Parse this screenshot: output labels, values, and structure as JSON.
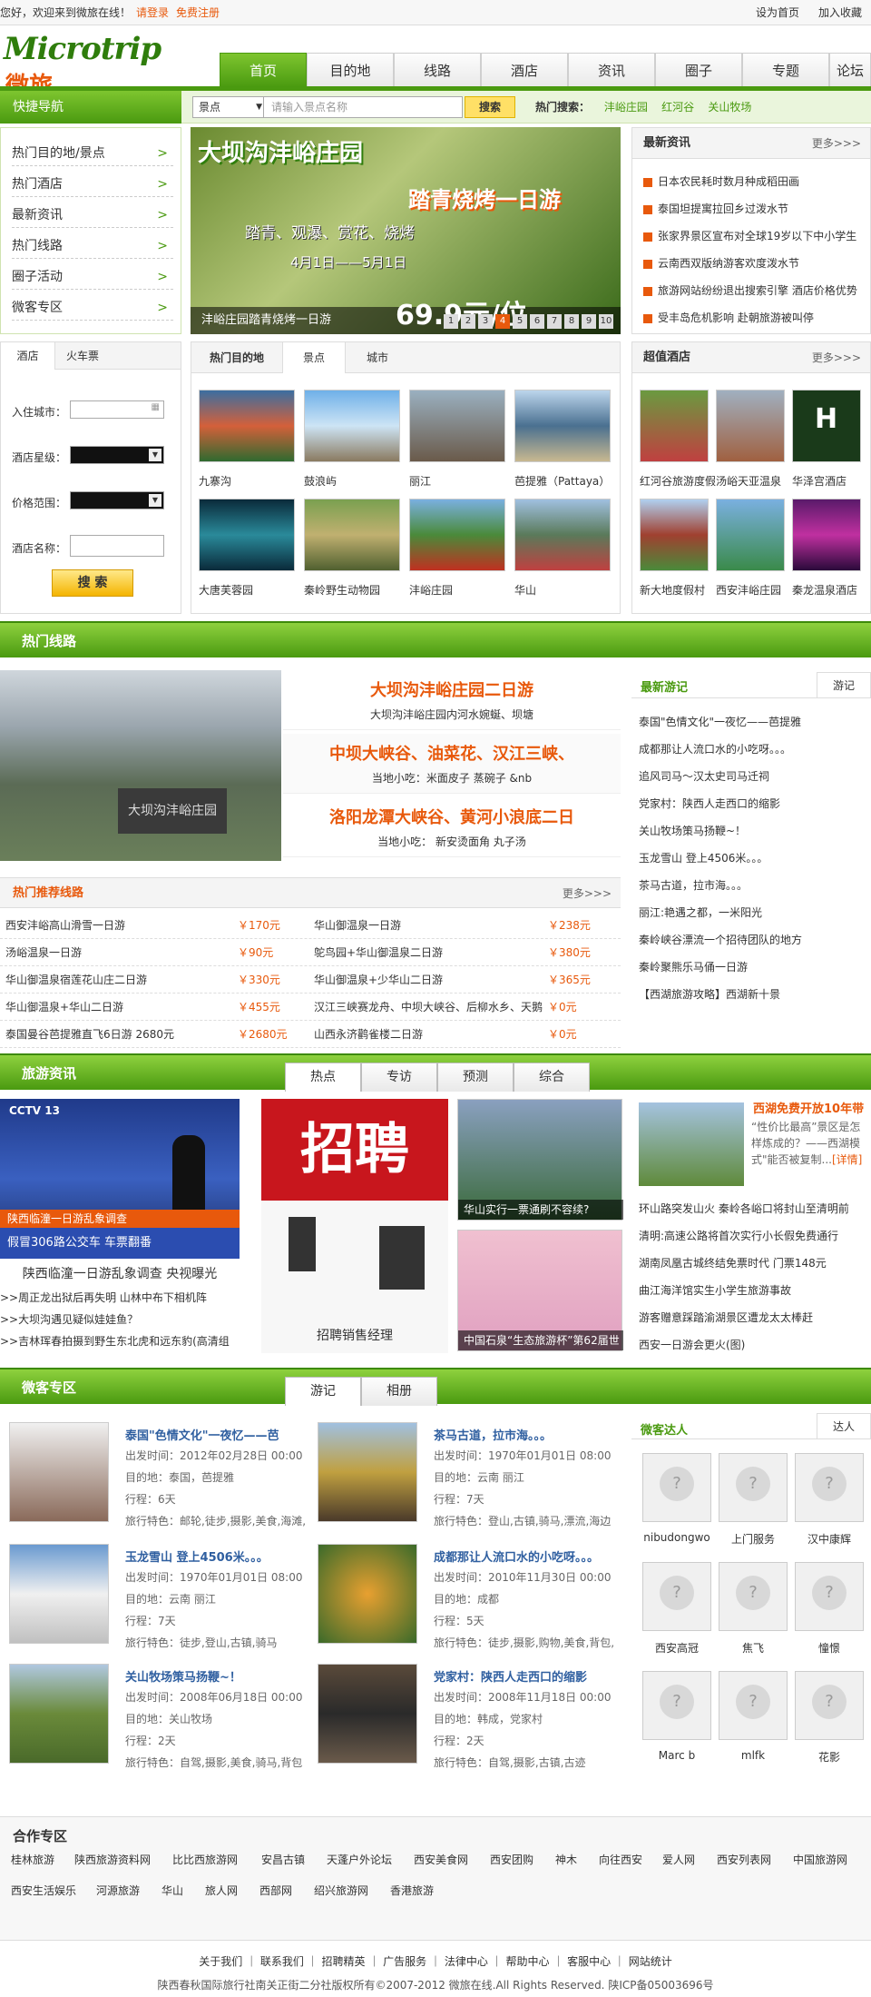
{
  "topbar": {
    "welcome": "您好，欢迎来到微旅在线！",
    "login": "请登录",
    "register": "免费注册",
    "set_home": "设为首页",
    "favorite": "加入收藏"
  },
  "logo": {
    "en": "Microtrip",
    "cn": "微旅"
  },
  "nav": [
    "首页",
    "目的地",
    "线路",
    "酒店",
    "资讯",
    "圈子",
    "专题",
    "论坛"
  ],
  "quicknav": {
    "title": "快捷导航",
    "items": [
      "热门目的地/景点",
      "热门酒店",
      "最新资讯",
      "热门线路",
      "圈子活动",
      "微客专区"
    ]
  },
  "search": {
    "type": "景点",
    "placeholder": "请输入景点名称",
    "button": "搜索",
    "hot_label": "热门搜索：",
    "hot": [
      "沣峪庄园",
      "红河谷",
      "关山牧场"
    ]
  },
  "banner": {
    "title": "大坝沟沣峪庄园",
    "subtitle": "踏青烧烤一日游",
    "tagline": "踏青、观瀑、赏花、烧烤",
    "dates": "4月1日——5月1日",
    "caption": "沣峪庄园踏青烧烤一日游",
    "price": "69.9元/位",
    "pages": [
      "1",
      "2",
      "3",
      "4",
      "5",
      "6",
      "7",
      "8",
      "9",
      "10"
    ]
  },
  "latest_news": {
    "title": "最新资讯",
    "more": "更多>>>",
    "items": [
      "日本农民耗时数月种成稻田画",
      "泰国坦提寓拉回乡过泼水节",
      "张家界景区宣布对全球19岁以下中小学生",
      "云南西双版纳游客欢度泼水节",
      "旅游网站纷纷退出搜索引擎 酒店价格优势",
      "受丰岛危机影响 赴朝旅游被叫停"
    ]
  },
  "hotel_form": {
    "tab1": "酒店",
    "tab2": "火车票",
    "city_label": "入住城市：",
    "star_label": "酒店星级：",
    "price_label": "价格范围：",
    "name_label": "酒店名称：",
    "button": "搜 索"
  },
  "destinations": {
    "title": "热门目的地",
    "tab2": "景点",
    "tab3": "城市",
    "items": [
      "九寨沟",
      "鼓浪屿",
      "丽江",
      "芭提雅（Pattaya）",
      "大唐芙蓉园",
      "秦岭野生动物园",
      "沣峪庄园",
      "华山"
    ]
  },
  "hotels": {
    "title": "超值酒店",
    "more": "更多>>>",
    "items": [
      "红河谷旅游度假",
      "汤峪天亚温泉",
      "华泽宫酒店",
      "新大地度假村",
      "西安沣峪庄园",
      "秦龙温泉酒店"
    ]
  },
  "hot_routes": {
    "title": "热门线路",
    "top": [
      {
        "title": "大坝沟沣峪庄园二日游",
        "desc": "大坝沟沣峪庄园内河水婉蜒、坝塘"
      },
      {
        "title": "中坝大峡谷、油菜花、汉江三峡、",
        "desc": "当地小吃：米面皮子 蒸碗子 &nb"
      },
      {
        "title": "洛阳龙潭大峡谷、黄河小浪底二日",
        "desc": "当地小吃：  新安烫面角 丸子汤"
      }
    ],
    "pic_text": "大坝沟沣峪庄园",
    "rec_title": "热门推荐线路",
    "rec_more": "更多>>>",
    "rec": [
      {
        "a": "西安沣峪高山滑雪一日游",
        "ap": "￥170元",
        "b": "华山御温泉一日游",
        "bp": "￥238元"
      },
      {
        "a": "汤峪温泉一日游",
        "ap": "￥90元",
        "b": "鸵鸟园+华山御温泉二日游",
        "bp": "￥380元"
      },
      {
        "a": "华山御温泉宿莲花山庄二日游",
        "ap": "￥330元",
        "b": "华山御温泉+少华山二日游",
        "bp": "￥365元"
      },
      {
        "a": "华山御温泉+华山二日游",
        "ap": "￥455元",
        "b": "汉江三峡赛龙舟、中坝大峡谷、后柳水乡、天鹅",
        "bp": "￥0元"
      },
      {
        "a": "泰国曼谷芭提雅直飞6日游 2680元",
        "ap": "￥2680元",
        "b": "山西永济鹳雀楼二日游",
        "bp": "￥0元"
      }
    ]
  },
  "travelogs": {
    "title": "最新游记",
    "tab": "游记",
    "items": [
      "泰国\"色情文化\"一夜忆——芭提雅",
      "成都那让人流口水的小吃呀。。。",
      "追风司马～汉太史司马迁祠",
      "党家村：陕西人走西口的缩影",
      "关山牧场策马扬鞭~！",
      "玉龙雪山 登上4506米。。。",
      "茶马古道，拉市海。。。",
      "丽江:艳遇之都，一米阳光",
      "秦岭峡谷漂流一个招待团队的地方",
      "秦岭聚熊乐马俑一日游",
      "【西湖旅游攻略】西湖新十景"
    ]
  },
  "news": {
    "title": "旅游资讯",
    "tabs": [
      "热点",
      "专访",
      "预测",
      "综合"
    ],
    "video_title": "陕西临潼一日游乱象调查 央视曝光",
    "video_bar": "假冒306路公交车 车票翻番",
    "video_bar2": "陕西临潼一日游乱象调查",
    "links": [
      ">>周正龙出狱后再失明 山林中布下相机阵",
      ">>大坝沟遇见疑似娃娃鱼？",
      ">>吉林珲春拍摄到野生东北虎和远东豹(高清组"
    ],
    "recruit_big": "招聘",
    "recruit_cap": "招聘销售经理",
    "img3a": "华山实行一票通刷不容续?",
    "img3b": "中国石泉“生态旅游杯”第62届世",
    "right_title": "西湖免费开放10年带",
    "right_desc": "“性价比最高”景区是怎样炼成的？——西湖模式\"能否被复制...",
    "right_detail": "[详情]",
    "right_list": [
      "环山路突发山火 秦岭各峪口将封山至清明前",
      "清明:高速公路将首次实行小长假免费通行",
      "湖南凤凰古城终结免票时代 门票148元",
      "曲江海洋馆实生小学生旅游事故",
      "游客赠意踩踏渝湖景区遭龙太太棒赶",
      "西安一日游会更火(图)"
    ]
  },
  "weike": {
    "title": "微客专区",
    "tabs": [
      "游记",
      "相册"
    ],
    "stories": [
      {
        "title": "泰国\"色情文化\"一夜忆——芭",
        "date": "出发时间：2012年02月28日 00:00",
        "dest": "目的地：泰国，芭提雅",
        "trip": "行程：6天",
        "feat": "旅行特色：邮轮,徒步,摄影,美食,海滩,"
      },
      {
        "title": "茶马古道，拉市海。。。",
        "date": "出发时间：1970年01月01日 08:00",
        "dest": "目的地：云南 丽江",
        "trip": "行程：7天",
        "feat": "旅行特色：登山,古镇,骑马,漂流,海边"
      },
      {
        "title": "玉龙雪山 登上4506米。。。",
        "date": "出发时间：1970年01月01日 08:00",
        "dest": "目的地：云南 丽江",
        "trip": "行程：7天",
        "feat": "旅行特色：徒步,登山,古镇,骑马"
      },
      {
        "title": "成都那让人流口水的小吃呀。。。",
        "date": "出发时间：2010年11月30日 00:00",
        "dest": "目的地：成都",
        "trip": "行程：5天",
        "feat": "旅行特色：徒步,摄影,购物,美食,背包,"
      },
      {
        "title": "关山牧场策马扬鞭~！",
        "date": "出发时间：2008年06月18日 00:00",
        "dest": "目的地：关山牧场",
        "trip": "行程：2天",
        "feat": "旅行特色：自驾,摄影,美食,骑马,背包"
      },
      {
        "title": "党家村：陕西人走西口的缩影",
        "date": "出发时间：2008年11月18日 00:00",
        "dest": "目的地：韩成，党家村",
        "trip": "行程：2天",
        "feat": "旅行特色：自驾,摄影,古镇,古迹"
      }
    ],
    "expert_title": "微客达人",
    "expert_tab": "达人",
    "experts": [
      "nibudongwo",
      "上门服务",
      "汉中康辉",
      "西安高冠",
      "焦飞",
      "憧憬",
      "Marc b",
      "mlfk",
      "花影"
    ]
  },
  "partner": {
    "title": "合作专区",
    "row1": [
      "桂林旅游",
      "陕西旅游资料网",
      "比比西旅游网",
      "安昌古镇",
      "天蓬户外论坛",
      "西安美食网",
      "西安团购",
      "神木",
      "向往西安",
      "爱人网",
      "西安列表网",
      "中国旅游网"
    ],
    "row2": [
      "西安生活娱乐",
      "河源旅游",
      "华山",
      "旅人网",
      "西部网",
      "绍兴旅游网",
      "香港旅游"
    ]
  },
  "footer": {
    "links": "关于我们 ｜ 联系我们 ｜ 招聘精英 ｜ 广告服务 ｜ 法律中心 ｜ 帮助中心 ｜ 客服中心 ｜ 网站统计",
    "copyright": "陕西春秋国际旅行社南关正街二分社版权所有©2007-2012 微旅在线.All Rights Reserved.  陕ICP备05003696号"
  }
}
